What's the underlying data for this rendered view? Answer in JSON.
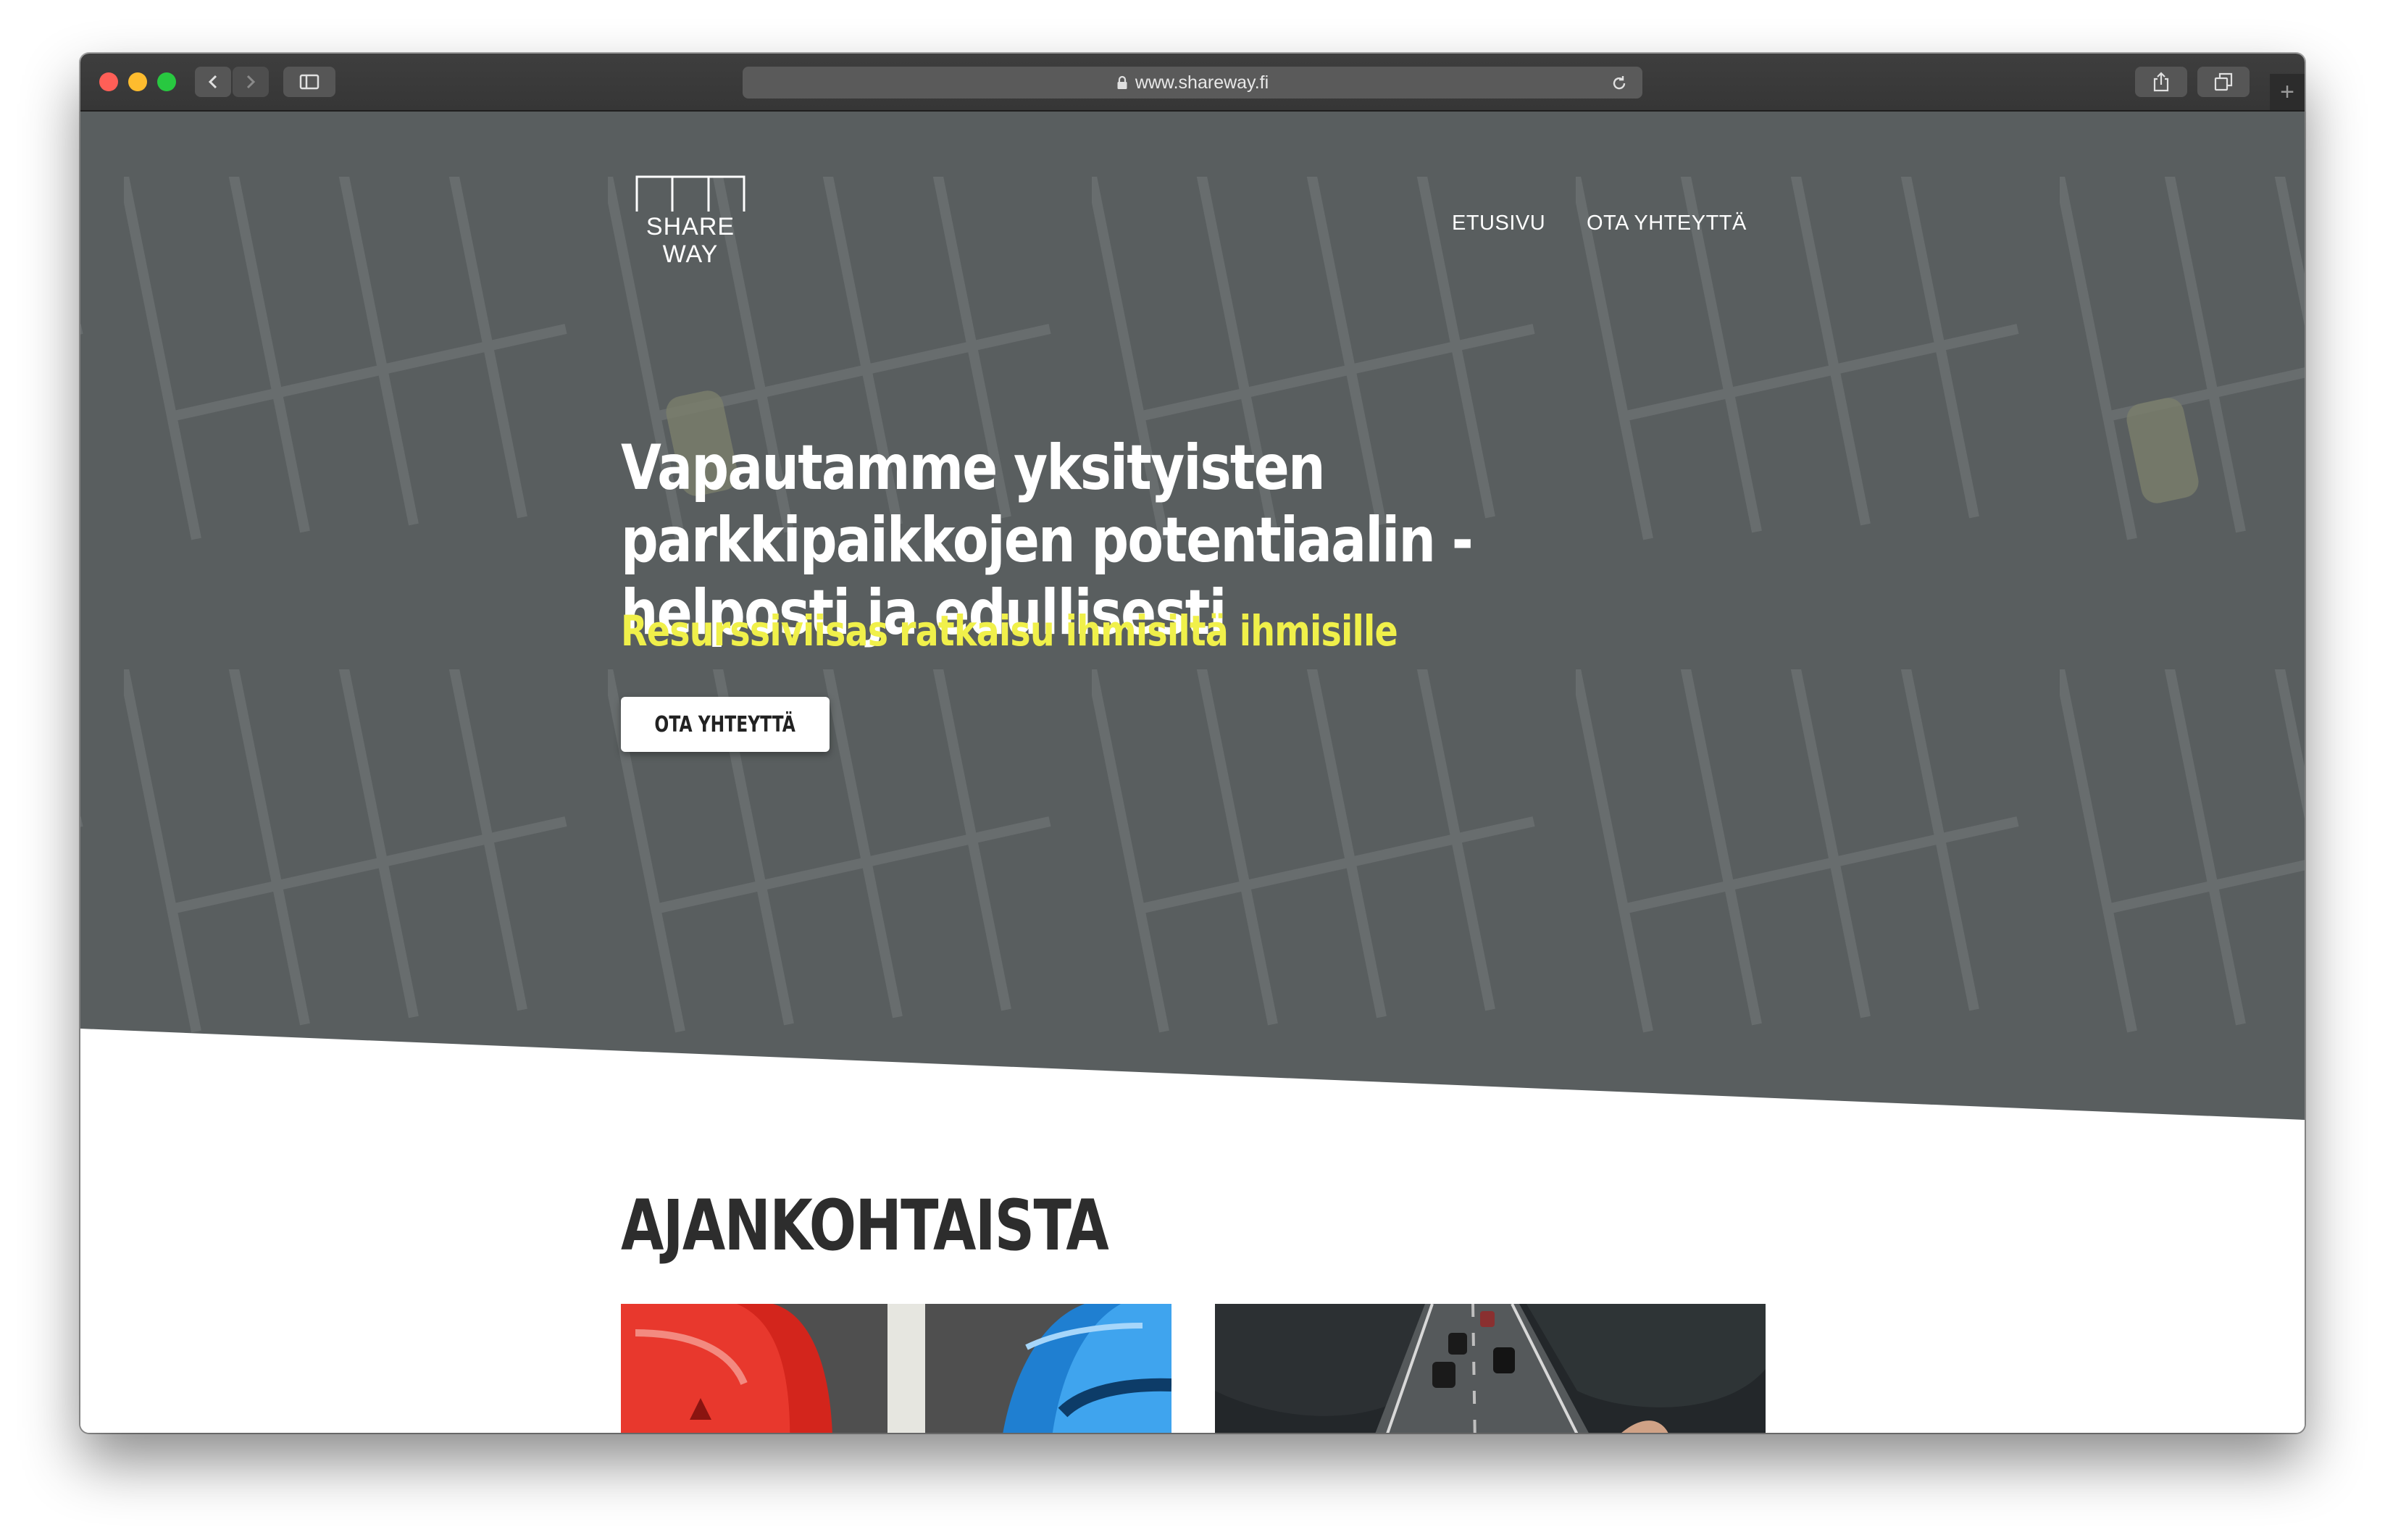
{
  "browser": {
    "url": "www.shareway.fi",
    "icons": {
      "back": "chevron-left-icon",
      "forward": "chevron-right-icon",
      "sidebar": "sidebar-icon",
      "lock": "lock-icon",
      "reload": "reload-icon",
      "share": "share-icon",
      "tabs": "tabs-icon",
      "new_tab": "plus-icon"
    },
    "new_tab_glyph": "+"
  },
  "site": {
    "logo": {
      "line1": "SHARE",
      "line2": "WAY"
    },
    "nav": [
      {
        "label": "ETUSIVU"
      },
      {
        "label": "OTA YHTEYTTÄ"
      }
    ]
  },
  "hero": {
    "title": "Vapautamme yksityisten parkkipaikkojen potentiaalin - helposti ja edullisesti",
    "subtitle": "Resurssiviisas ratkaisu ihmisiltä ihmisille",
    "cta_label": "OTA YHTEYTTÄ",
    "colors": {
      "background": "#595e5f",
      "subtitle": "#f0f04a"
    }
  },
  "news": {
    "title": "AJANKOHTAISTA",
    "cards": [
      {
        "image": "parked-cars-top-view-image"
      },
      {
        "image": "highway-in-hands-image"
      }
    ]
  }
}
